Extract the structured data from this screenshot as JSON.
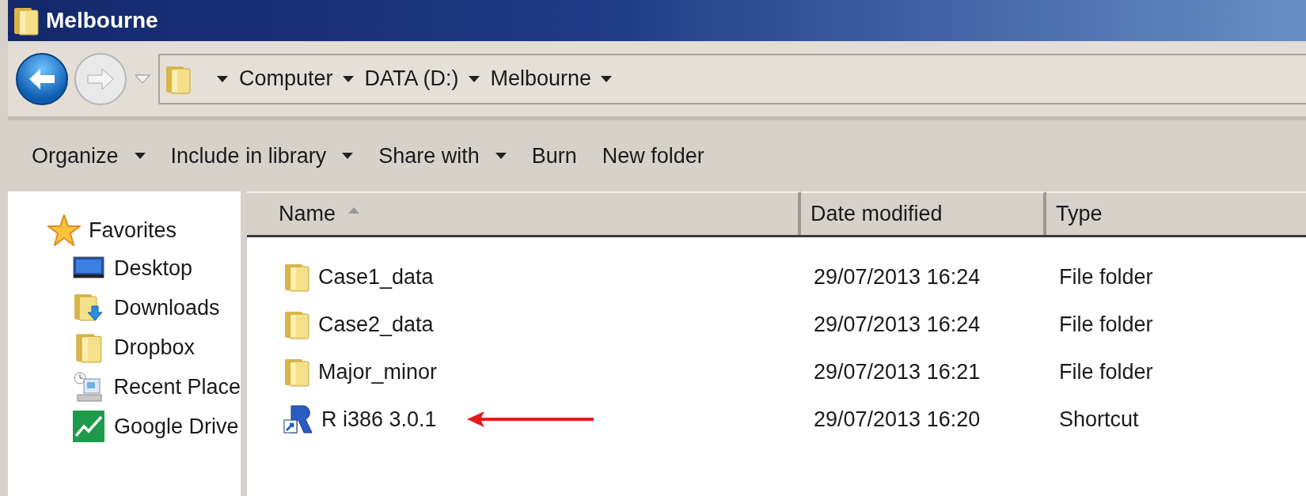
{
  "window": {
    "title": "Melbourne"
  },
  "nav": {
    "back": {
      "disabled": false
    },
    "forward": {
      "disabled": true
    }
  },
  "breadcrumb": [
    "Computer",
    "DATA (D:)",
    "Melbourne"
  ],
  "toolbar": [
    {
      "label": "Organize",
      "dropdown": true
    },
    {
      "label": "Include in library",
      "dropdown": true
    },
    {
      "label": "Share with",
      "dropdown": true
    },
    {
      "label": "Burn",
      "dropdown": false
    },
    {
      "label": "New folder",
      "dropdown": false
    }
  ],
  "sidebar": {
    "group": "Favorites",
    "items": [
      {
        "label": "Desktop",
        "kind": "desktop"
      },
      {
        "label": "Downloads",
        "kind": "downloads"
      },
      {
        "label": "Dropbox",
        "kind": "folder"
      },
      {
        "label": "Recent Place",
        "kind": "recent"
      },
      {
        "label": "Google Drive",
        "kind": "drive"
      }
    ]
  },
  "table": {
    "columns": [
      {
        "label": "Name",
        "sorted": true
      },
      {
        "label": "Date modified",
        "sorted": false
      },
      {
        "label": "Type",
        "sorted": false
      }
    ],
    "rows": [
      {
        "name": "Case1_data",
        "date": "29/07/2013 16:24",
        "type": "File folder",
        "kind": "folder",
        "marked": false
      },
      {
        "name": "Case2_data",
        "date": "29/07/2013 16:24",
        "type": "File folder",
        "kind": "folder",
        "marked": false
      },
      {
        "name": "Major_minor",
        "date": "29/07/2013 16:21",
        "type": "File folder",
        "kind": "folder",
        "marked": false
      },
      {
        "name": "R i386 3.0.1",
        "date": "29/07/2013 16:20",
        "type": "Shortcut",
        "kind": "shortcut",
        "marked": true
      }
    ]
  }
}
